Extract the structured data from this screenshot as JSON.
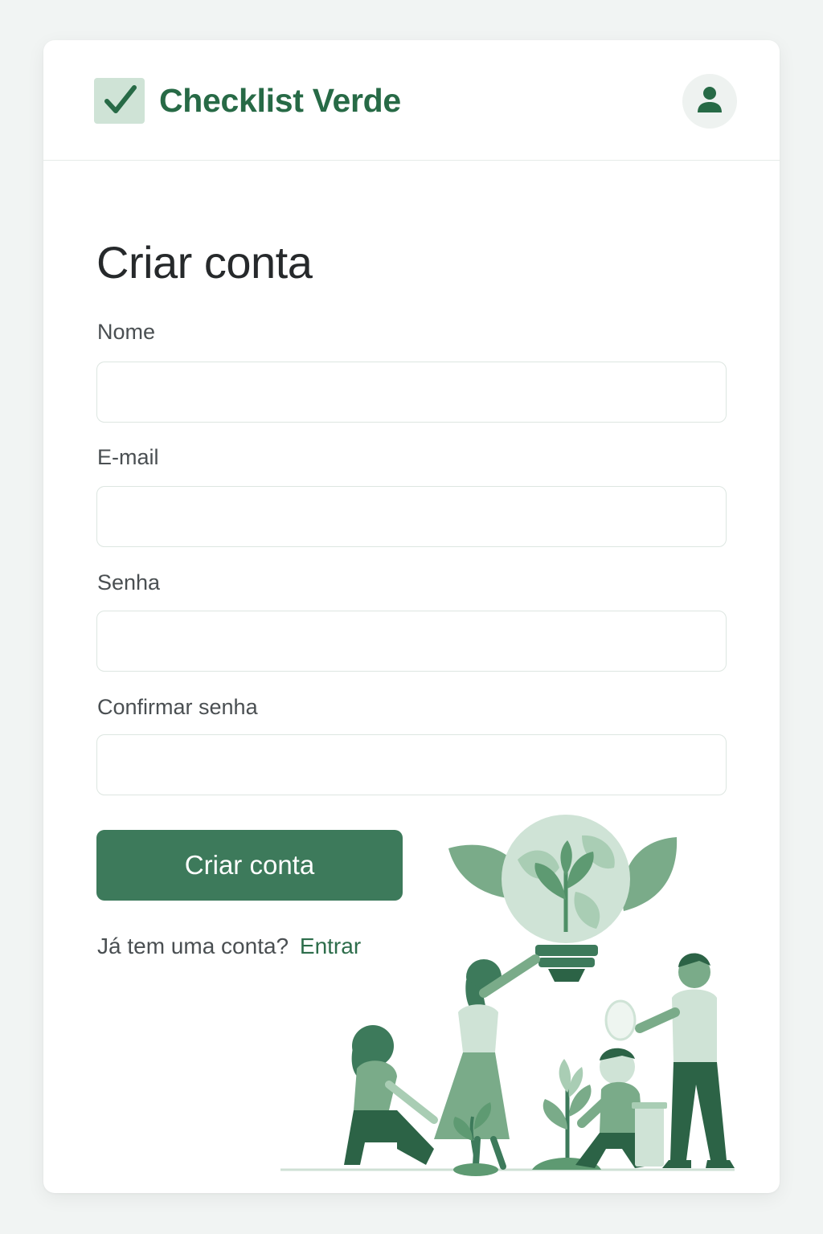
{
  "app": {
    "brand_name": "Checklist Verde",
    "logo_icon": "checkmark-icon",
    "account_icon": "user-icon"
  },
  "form": {
    "title": "Criar conta",
    "fields": [
      {
        "label": "Nome",
        "value": "",
        "placeholder": ""
      },
      {
        "label": "E-mail",
        "value": "",
        "placeholder": ""
      },
      {
        "label": "Senha",
        "value": "",
        "placeholder": ""
      },
      {
        "label": "Confirmar senha",
        "value": "",
        "placeholder": ""
      }
    ],
    "submit_label": "Criar conta",
    "login_prompt": "Já tem uma conta?",
    "login_link": "Entrar"
  },
  "colors": {
    "brand": "#276a46",
    "button": "#3d7a5b",
    "logo_bg": "#cfe3d6",
    "page_bg": "#f1f4f3"
  }
}
